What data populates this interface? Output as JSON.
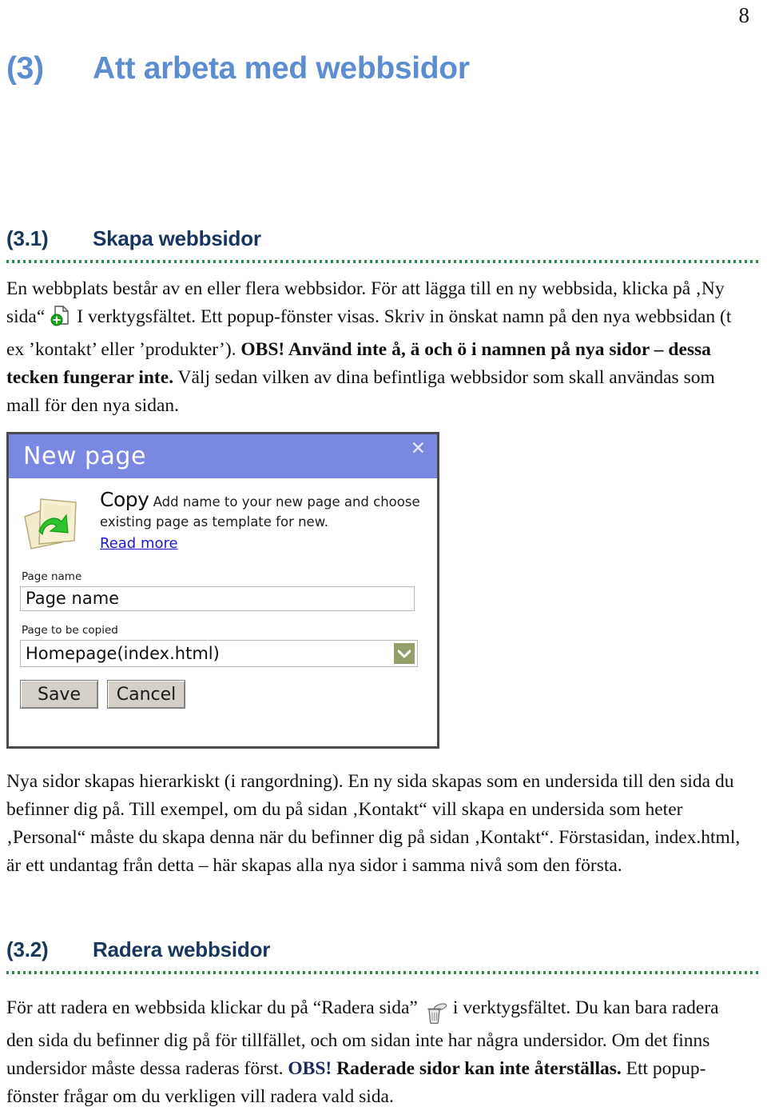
{
  "page": {
    "number": "8"
  },
  "chapter": {
    "number": "(3)",
    "title": "Att arbeta med webbsidor"
  },
  "sections": [
    {
      "number": "(3.1)",
      "title": "Skapa webbsidor"
    },
    {
      "number": "(3.2)",
      "title": "Radera webbsidor"
    }
  ],
  "paragraphs": {
    "intro_p1": "En webbplats består av en eller flera webbsidor. För att lägga till en ny webbsida, klicka på",
    "intro_p2": "‚Ny sida“",
    "intro_p3": "I verktygsfältet. Ett popup-fönster visas. Skriv in önskat namn på den nya webbsidan (t ex ’kontakt’ eller ’produkter’).",
    "intro_bold": "OBS! Använd inte å, ä och ö i namnen på nya sidor – dessa tecken fungerar inte.",
    "intro_p4": "Välj sedan vilken av dina befintliga webbsidor som skall användas som mall för den nya sidan.",
    "hierarchy": "Nya sidor skapas hierarkiskt (i rangordning).  En ny sida skapas som en undersida till den sida du befinner dig på. Till exempel, om du på sidan ‚Kontakt“ vill skapa en undersida som heter ‚Personal“ måste du skapa denna när du befinner dig på sidan ‚Kontakt“. Förstasidan, index.html, är ett undantag från detta – här skapas alla nya sidor i samma nivå som den första.",
    "delete_p1": "För att radera en webbsida klickar du på “Radera sida”",
    "delete_p2": "i verktygsfältet. Du kan bara radera den sida du befinner dig på för tillfället, och om sidan inte har några undersidor. Om det finns undersidor måste dessa raderas först.",
    "delete_obs": "OBS!",
    "delete_bold": "Raderade sidor kan inte återställas.",
    "delete_p3": "Ett popup-fönster frågar om du verkligen vill radera vald sida."
  },
  "dialog": {
    "title": "New page",
    "close_label": "✕",
    "copy_heading": "Copy",
    "copy_description": "Add name to your new page and choose existing page as template for new.",
    "read_more": "Read more",
    "page_name_label": "Page name",
    "page_name_value": "Page name",
    "page_to_copy_label": "Page to be copied",
    "page_to_copy_value": "Homepage(index.html)",
    "save_label": "Save",
    "cancel_label": "Cancel"
  },
  "colors": {
    "chapter_heading": "#5b8dd0",
    "section_heading": "#17365d",
    "divider_green": "#2f8c4f",
    "titlebar_blue": "#7b88e2",
    "link_blue": "#1a1ad0",
    "dropdown_green": "#93a06a",
    "obs_navy": "#1b2a63"
  }
}
